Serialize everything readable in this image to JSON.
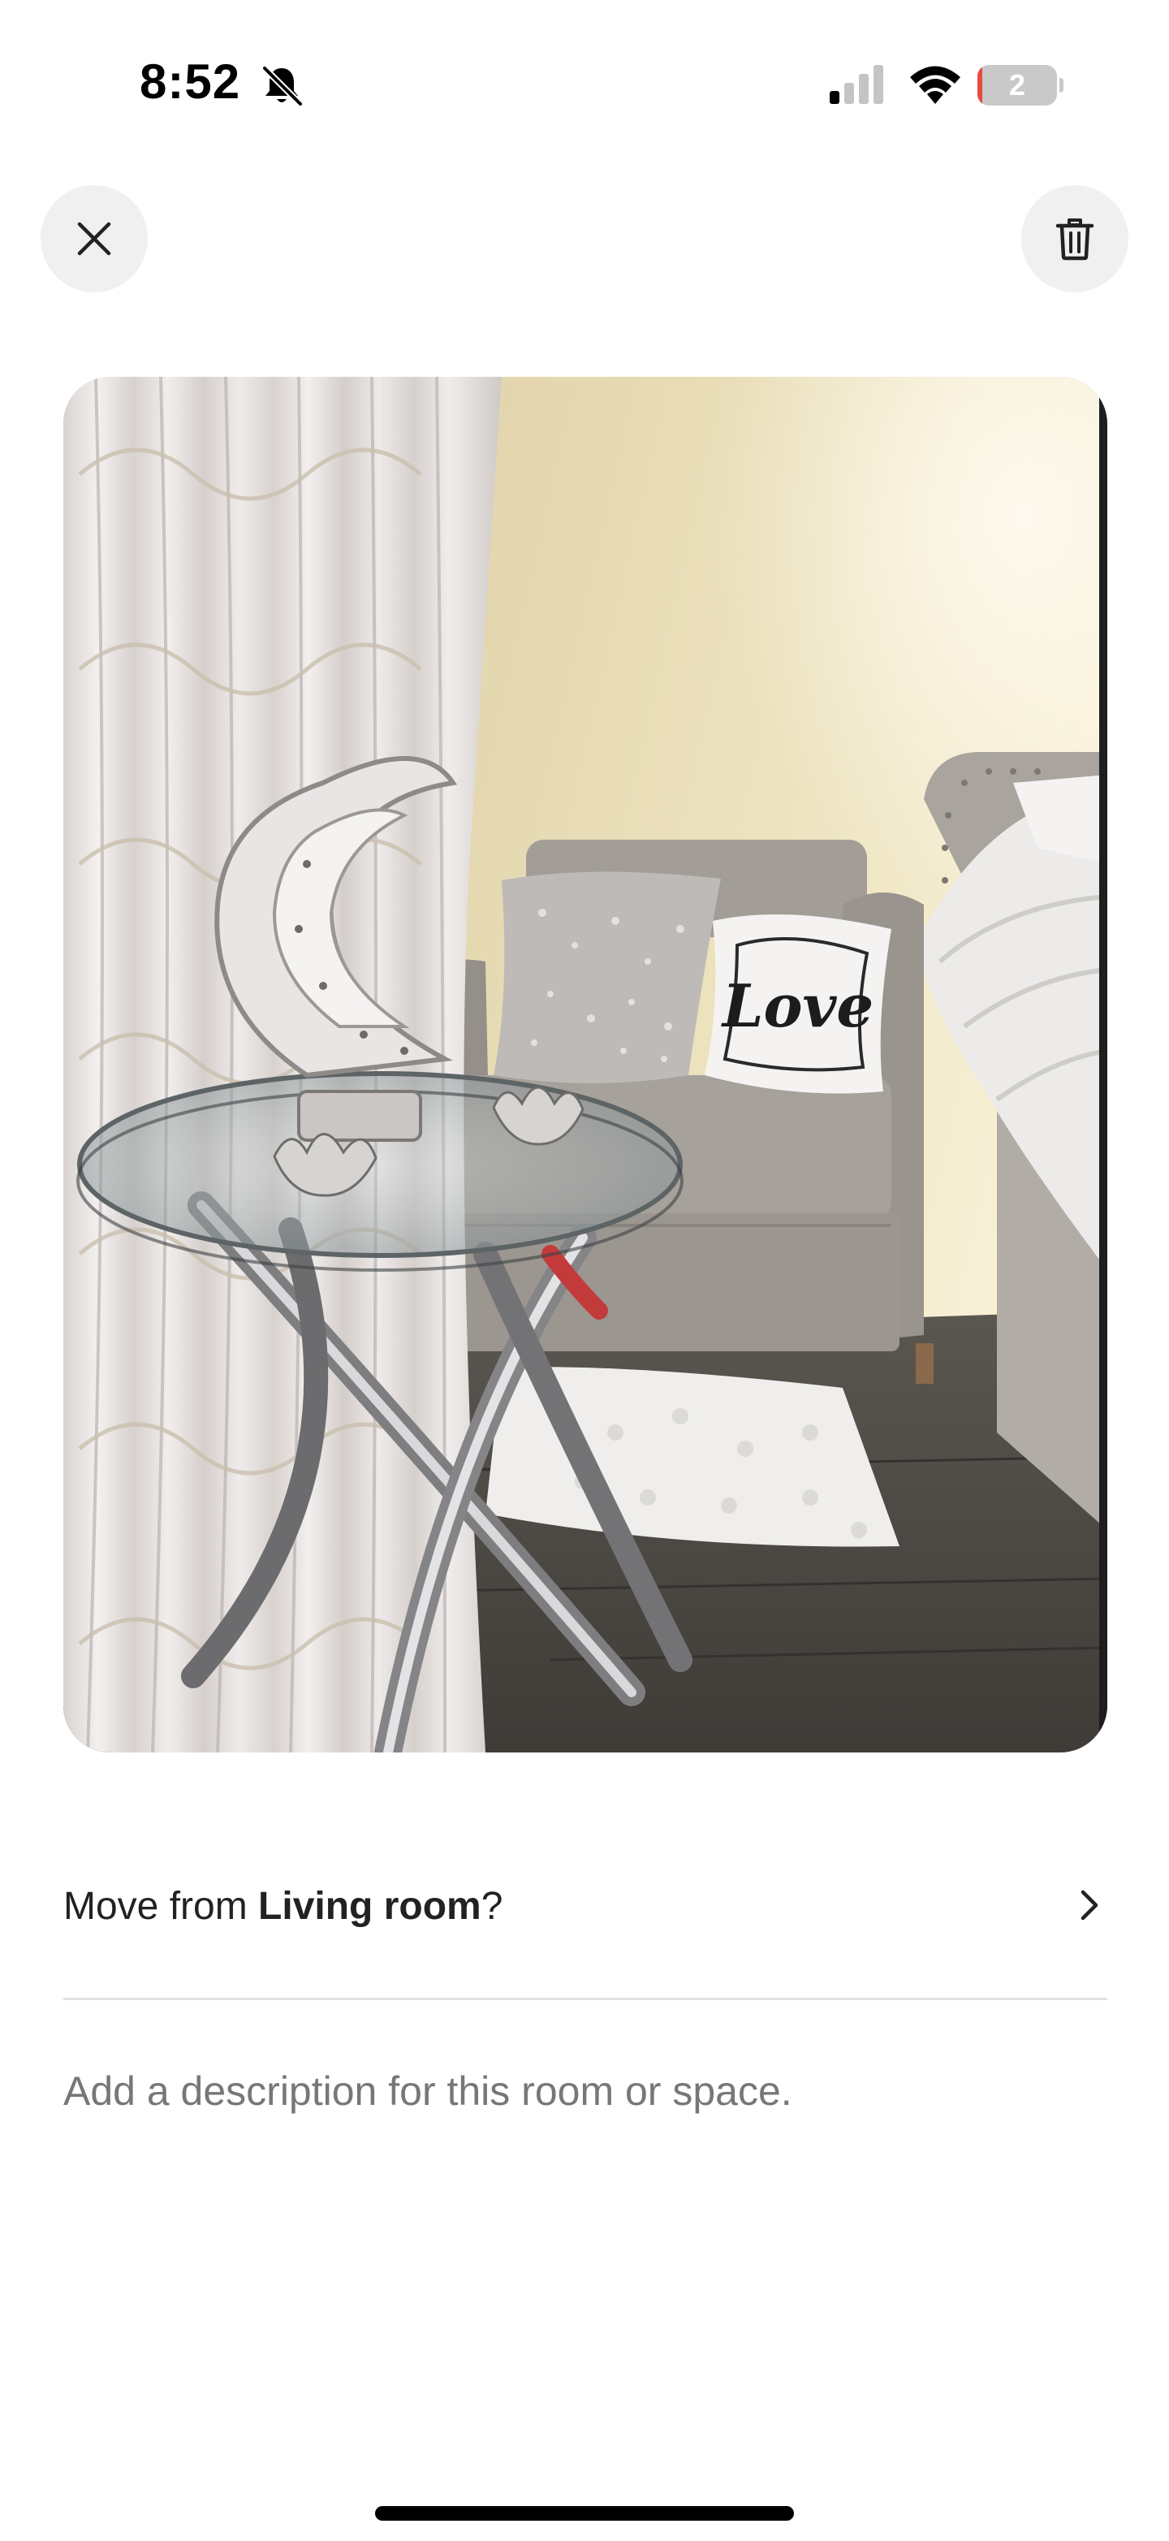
{
  "status_bar": {
    "time": "8:52",
    "battery_level": "2",
    "battery_percent": 2,
    "icons": [
      "bell-slash-icon",
      "cellular-signal-icon",
      "wifi-icon",
      "battery-icon"
    ]
  },
  "header": {
    "close_icon": "close-icon",
    "delete_icon": "trash-icon"
  },
  "photo": {
    "pillow_text": "Love"
  },
  "move_row": {
    "prefix": "Move from ",
    "room": "Living room",
    "suffix": "?",
    "chevron_icon": "chevron-right-icon"
  },
  "description": {
    "placeholder": "Add a description for this room or space.",
    "value": ""
  },
  "colors": {
    "button_bg": "#f0f0f0",
    "text": "#222222",
    "placeholder": "#777777",
    "battery_low": "#e74a3f"
  }
}
